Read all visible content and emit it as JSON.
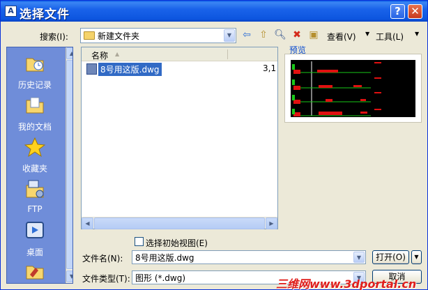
{
  "window": {
    "title": "选择文件",
    "help": "?",
    "close": "✕"
  },
  "toolbar": {
    "search_label": "搜索(I):",
    "search_value": "新建文件夹",
    "view_label": "查看(V)",
    "tools_label": "工具(L)"
  },
  "places": [
    {
      "label": "历史记录",
      "icon": "history-folder-icon"
    },
    {
      "label": "我的文档",
      "icon": "my-documents-icon"
    },
    {
      "label": "收藏夹",
      "icon": "favorites-star-icon"
    },
    {
      "label": "FTP",
      "icon": "ftp-icon"
    },
    {
      "label": "桌面",
      "icon": "desktop-icon"
    }
  ],
  "filelist": {
    "column_name": "名称",
    "files": [
      {
        "name": "8号用这版.dwg",
        "size": "3,1"
      }
    ]
  },
  "preview": {
    "label": "预览"
  },
  "options": {
    "initial_view_label": "选择初始视图(E)"
  },
  "filename": {
    "label": "文件名(N):",
    "value": "8号用这版.dwg"
  },
  "filetype": {
    "label": "文件类型(T):",
    "value": "图形 (*.dwg)"
  },
  "buttons": {
    "open": "打开(O)",
    "cancel": "取消"
  },
  "watermark": "三维网www.3dportal.cn"
}
